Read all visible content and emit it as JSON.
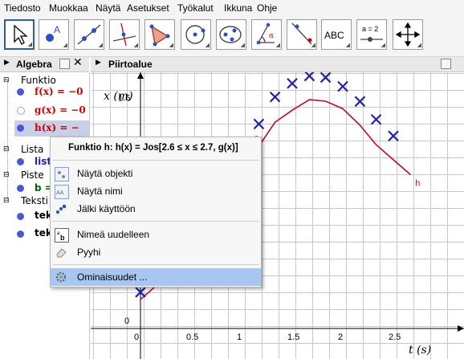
{
  "menu": [
    "Tiedosto",
    "Muokkaa",
    "Näytä",
    "Asetukset",
    "Työkalut",
    "Ikkuna",
    "Ohje"
  ],
  "toolbar": {
    "tools": [
      "move-tool",
      "point-tool",
      "line-tool",
      "perpendicular-line-tool",
      "polygon-tool",
      "circle-tool",
      "conic-tool",
      "angle-tool",
      "reflect-tool",
      "text-tool",
      "slider-tool",
      "move-view-tool"
    ],
    "text_label": "ABC",
    "slider_label": "a = 2"
  },
  "algebra": {
    "title": "Algebra",
    "sections": [
      {
        "name": "Funktio"
      },
      {
        "name": "Lista"
      },
      {
        "name": "Piste"
      },
      {
        "name": "Teksti"
      }
    ],
    "items": {
      "f": "f(x) = −0",
      "g": "g(x) = −0",
      "h": "h(x) = −",
      "list": "list",
      "b": "b = ",
      "tek1": "tek",
      "tek2": "tek"
    }
  },
  "graphics": {
    "title": "Piirtoalue",
    "y_axis_label": "x (m)",
    "x_axis_label": "t (s)",
    "curve_label": "h"
  },
  "context_menu": {
    "title": "Funktio h: h(x) = Jos[2.6 ≤ x ≤ 2.7, g(x)]",
    "items": [
      "Näytä objekti",
      "Näytä nimi",
      "Jälki käyttöön",
      "Nimeä uudelleen",
      "Pyyhi",
      "Ominaisuudet ..."
    ]
  },
  "chart_data": {
    "type": "scatter",
    "xlabel": "t (s)",
    "ylabel": "x (m)",
    "x_ticks": [
      "0",
      "0.5",
      "1",
      "1.5",
      "2",
      "2.5"
    ],
    "y_ticks": [
      "1.5",
      "0"
    ],
    "xlim": [
      -0.45,
      2.85
    ],
    "ylim": [
      0,
      1.6
    ],
    "series": [
      {
        "name": "h",
        "values_x": [
          0.0,
          0.17,
          0.33,
          0.5,
          0.67,
          0.83,
          1.0,
          1.17,
          1.33,
          1.5,
          1.67,
          1.83,
          2.0,
          2.17,
          2.33,
          2.5,
          2.67
        ],
        "values_y": [
          0.14,
          0.24,
          0.41,
          0.55,
          0.7,
          0.88,
          1.06,
          1.16,
          1.32,
          1.4,
          1.47,
          1.46,
          1.41,
          1.3,
          1.17,
          1.07,
          0.97
        ]
      },
      {
        "name": "",
        "values_x": [
          0.0,
          0.17,
          1.17,
          1.33,
          1.5,
          1.67,
          1.83,
          2.0,
          2.17,
          2.33,
          2.5
        ],
        "values_y": [
          0.14,
          0.24,
          1.26,
          1.44,
          1.53,
          1.58,
          1.57,
          1.51,
          1.41,
          1.29,
          1.18
        ]
      }
    ],
    "colors": {
      "curve": "#cc0033",
      "markers": "#1f1fb4",
      "grid": "#c8c8c8"
    }
  }
}
